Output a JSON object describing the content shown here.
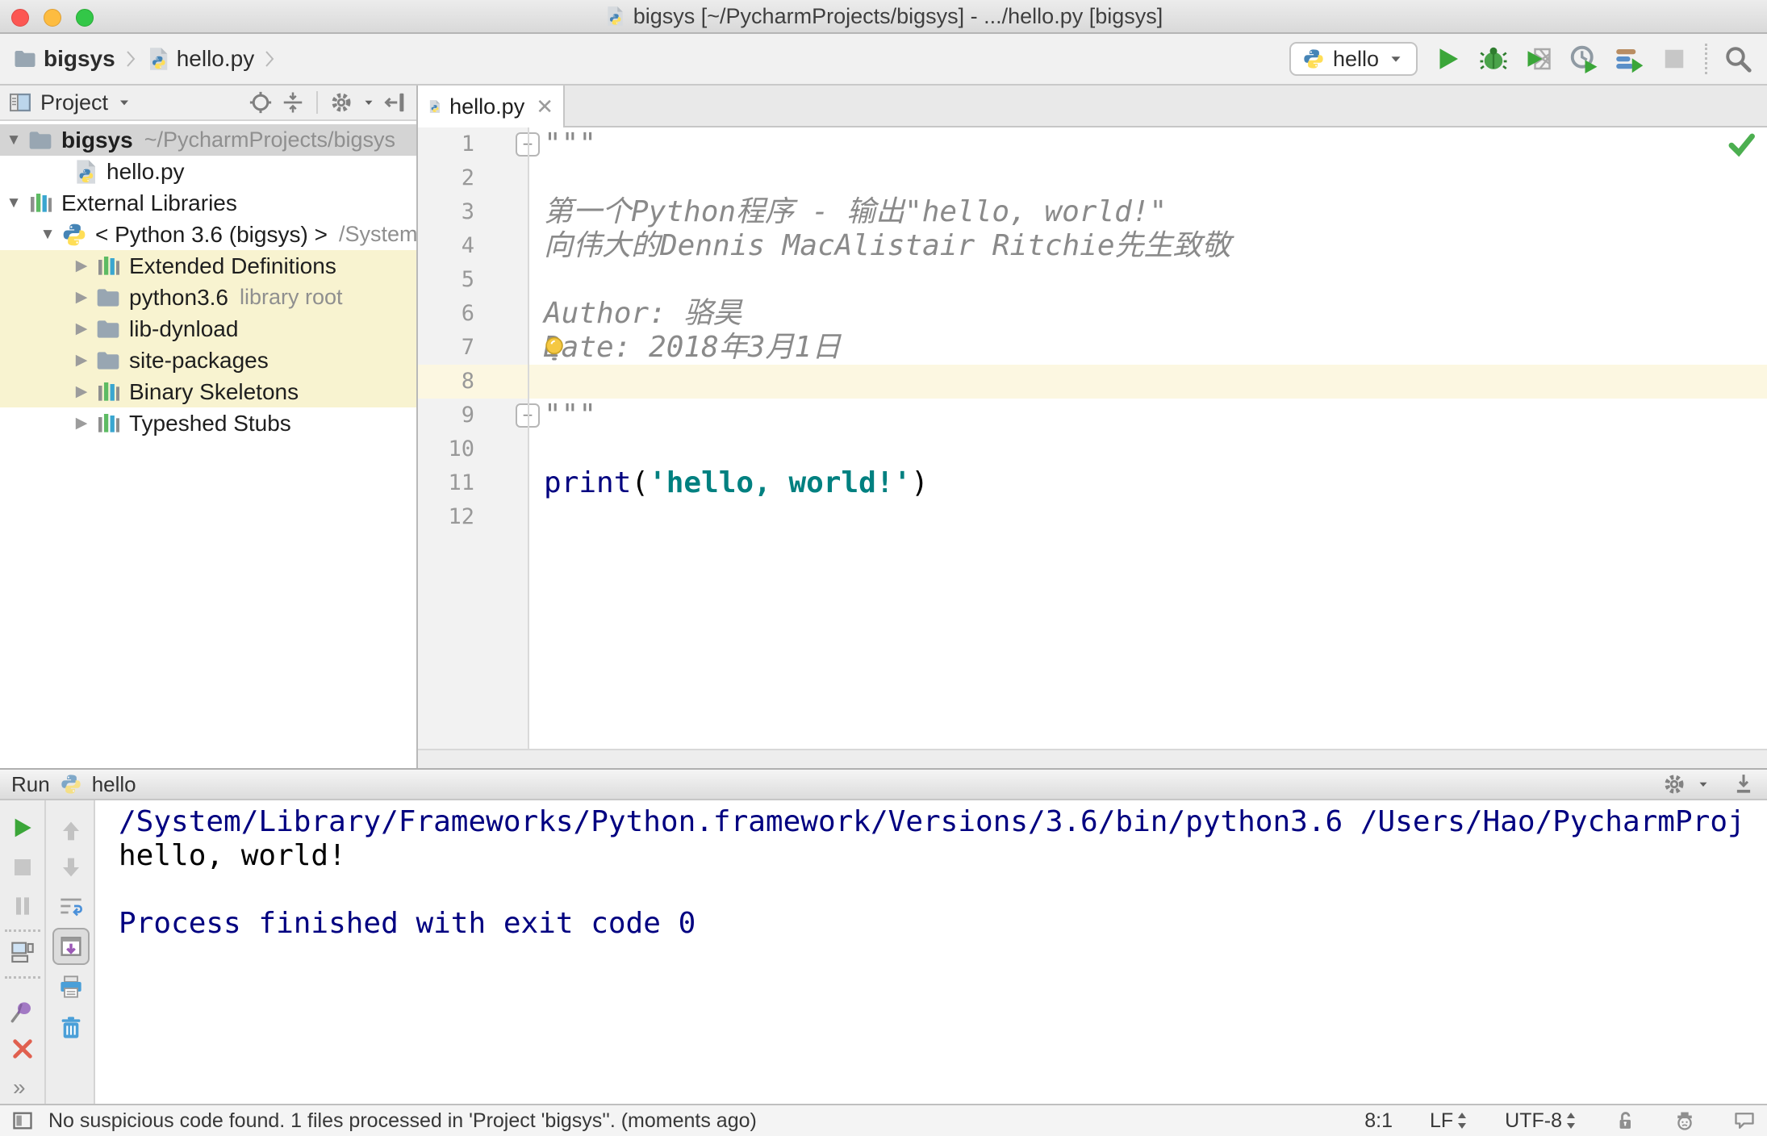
{
  "window": {
    "title": "bigsys [~/PycharmProjects/bigsys] - .../hello.py [bigsys]"
  },
  "navbar": {
    "breadcrumbs": [
      {
        "label": "bigsys"
      },
      {
        "label": "hello.py"
      }
    ],
    "run_config": {
      "label": "hello"
    }
  },
  "project_panel": {
    "title": "Project",
    "tree": [
      {
        "label": "bigsys",
        "bold": true,
        "hint": "~/PycharmProjects/bigsys",
        "icon": "folder",
        "state": "expanded",
        "depth": 0,
        "selected": true
      },
      {
        "label": "hello.py",
        "icon": "pyfile",
        "state": "none",
        "depth": 1
      },
      {
        "label": "External Libraries",
        "icon": "library",
        "state": "expanded",
        "depth": 0
      },
      {
        "label": "< Python 3.6 (bigsys) >",
        "hint": "/System",
        "icon": "python",
        "state": "expanded",
        "depth": 1
      },
      {
        "label": "Extended Definitions",
        "icon": "library",
        "state": "collapsed",
        "depth": 2,
        "highlight": true
      },
      {
        "label": "python3.6",
        "hint": "library root",
        "icon": "folder",
        "state": "collapsed",
        "depth": 2,
        "highlight": true
      },
      {
        "label": "lib-dynload",
        "icon": "folder",
        "state": "collapsed",
        "depth": 2,
        "highlight": true
      },
      {
        "label": "site-packages",
        "icon": "folder",
        "state": "collapsed",
        "depth": 2,
        "highlight": true
      },
      {
        "label": "Binary Skeletons",
        "icon": "library",
        "state": "collapsed",
        "depth": 2,
        "highlight": true
      },
      {
        "label": "Typeshed Stubs",
        "icon": "library",
        "state": "collapsed",
        "depth": 2
      }
    ]
  },
  "editor": {
    "tab": {
      "label": "hello.py"
    },
    "lines": [
      {
        "n": 1,
        "fold": "top",
        "segs": [
          [
            "doc",
            "\"\"\""
          ]
        ]
      },
      {
        "n": 2,
        "segs": []
      },
      {
        "n": 3,
        "segs": [
          [
            "doc",
            "第一个Python程序 - 输出\"hello, world!\""
          ]
        ]
      },
      {
        "n": 4,
        "segs": [
          [
            "doc",
            "向伟大的Dennis MacAlistair Ritchie先生致敬"
          ]
        ]
      },
      {
        "n": 5,
        "segs": []
      },
      {
        "n": 6,
        "segs": [
          [
            "doc",
            "Author: 骆昊"
          ]
        ]
      },
      {
        "n": 7,
        "bulb": true,
        "segs": [
          [
            "doc",
            "Date: 2018年3月1日"
          ]
        ]
      },
      {
        "n": 8,
        "current": true,
        "segs": []
      },
      {
        "n": 9,
        "fold": "bottom",
        "segs": [
          [
            "doc",
            "\"\"\""
          ]
        ]
      },
      {
        "n": 10,
        "segs": []
      },
      {
        "n": 11,
        "segs": [
          [
            "kw",
            "print"
          ],
          [
            "pl",
            "("
          ],
          [
            "str",
            "'hello, world!'"
          ],
          [
            "pl",
            ")"
          ]
        ]
      },
      {
        "n": 12,
        "segs": []
      }
    ]
  },
  "run_panel": {
    "title": "Run",
    "config_label": "hello",
    "console": [
      {
        "cls": "sys",
        "text": "/System/Library/Frameworks/Python.framework/Versions/3.6/bin/python3.6 /Users/Hao/PycharmProj"
      },
      {
        "cls": "out",
        "text": "hello, world!"
      },
      {
        "cls": "out",
        "text": ""
      },
      {
        "cls": "sys",
        "text": "Process finished with exit code 0"
      }
    ]
  },
  "status_bar": {
    "message": "No suspicious code found. 1 files processed in 'Project 'bigsys''. (moments ago)",
    "position": "8:1",
    "line_ending": "LF",
    "encoding": "UTF-8"
  },
  "colors": {
    "accent_green": "#3ba639",
    "keyword": "#000080",
    "string": "#008080",
    "docstring": "#8a8a8a",
    "console_system": "#000080",
    "current_line": "#fcf7e1",
    "tree_highlight": "#f8f3d0",
    "selected_row": "#d4d4d4"
  }
}
